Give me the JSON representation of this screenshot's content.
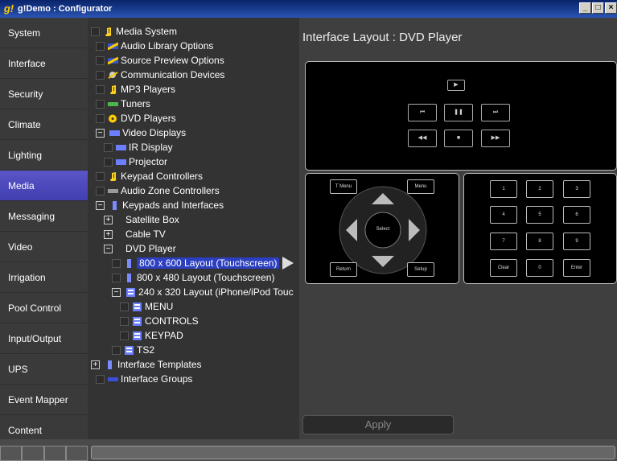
{
  "window": {
    "title": "g!Demo : Configurator",
    "icon": "g-logo-icon"
  },
  "sidebar": {
    "items": [
      {
        "label": "System"
      },
      {
        "label": "Interface"
      },
      {
        "label": "Security"
      },
      {
        "label": "Climate"
      },
      {
        "label": "Lighting"
      },
      {
        "label": "Media",
        "active": true
      },
      {
        "label": "Messaging"
      },
      {
        "label": "Video"
      },
      {
        "label": "Irrigation"
      },
      {
        "label": "Pool Control"
      },
      {
        "label": "Input/Output"
      },
      {
        "label": "UPS"
      },
      {
        "label": "Event Mapper"
      },
      {
        "label": "Content"
      }
    ]
  },
  "tree": {
    "nodes": [
      {
        "label": "Media System",
        "icon": "music-note-icon"
      },
      {
        "label": "Audio Library Options",
        "icon": "library-icon"
      },
      {
        "label": "Source Preview Options",
        "icon": "preview-icon"
      },
      {
        "label": "Communication Devices",
        "icon": "satellite-icon"
      },
      {
        "label": "MP3 Players",
        "icon": "music-note-icon"
      },
      {
        "label": "Tuners",
        "icon": "tuner-icon"
      },
      {
        "label": "DVD Players",
        "icon": "disc-icon"
      },
      {
        "label": "Video Displays",
        "icon": "display-icon"
      },
      {
        "label": "IR Display",
        "icon": "display-icon"
      },
      {
        "label": "Projector",
        "icon": "display-icon"
      },
      {
        "label": "Keypad Controllers",
        "icon": "music-note-icon"
      },
      {
        "label": "Audio Zone Controllers",
        "icon": "zone-icon"
      },
      {
        "label": "Keypads and Interfaces",
        "icon": "keypad-icon"
      },
      {
        "label": "Satellite Box",
        "icon": ""
      },
      {
        "label": "Cable TV",
        "icon": ""
      },
      {
        "label": "DVD Player",
        "icon": ""
      },
      {
        "label": "800 x 600 Layout (Touchscreen)",
        "icon": "keypad-icon",
        "selected": true
      },
      {
        "label": "800 x 480 Layout (Touchscreen)",
        "icon": "keypad-icon"
      },
      {
        "label": "240 x 320 Layout (iPhone/iPod Touc",
        "icon": "layout-icon"
      },
      {
        "label": "MENU",
        "icon": "layout-icon"
      },
      {
        "label": "CONTROLS",
        "icon": "layout-icon"
      },
      {
        "label": "KEYPAD",
        "icon": "layout-icon"
      },
      {
        "label": "TS2",
        "icon": "layout-icon"
      },
      {
        "label": "Interface Templates",
        "icon": "keypad-icon"
      },
      {
        "label": "Interface Groups",
        "icon": "group-icon"
      }
    ]
  },
  "content": {
    "title": "Interface Layout : DVD Player",
    "transport": {
      "play": "▶",
      "prev": "⏮",
      "pause": "❚❚",
      "next": "⏭",
      "rewind": "◀◀",
      "stop": "■",
      "forward": "▶▶"
    },
    "nav": {
      "top_menu": "T Menu",
      "menu": "Menu",
      "select": "Select",
      "return": "Return",
      "setup": "Setup"
    },
    "keypad": [
      "1",
      "2",
      "3",
      "4",
      "5",
      "6",
      "7",
      "8",
      "9",
      "Clear",
      "0",
      "Enter"
    ],
    "apply_label": "Apply"
  },
  "colors": {
    "accent": "#4a47be",
    "background": "#3f3f3f"
  }
}
